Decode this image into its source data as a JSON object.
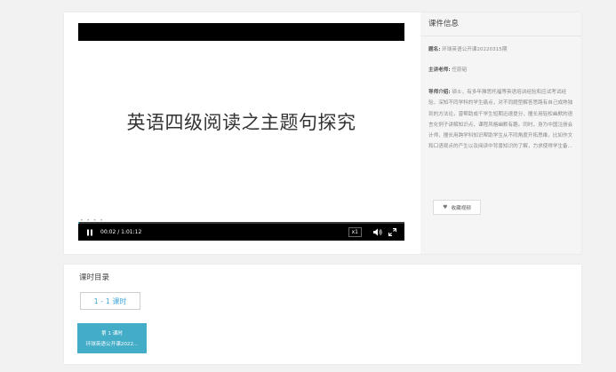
{
  "player": {
    "slide_title": "英语四级阅读之主题句探究",
    "time": "00:02 / 1:01:12",
    "rate": "x1",
    "progress": 0.0005,
    "progress_dots": "• • • •"
  },
  "info": {
    "header": "课件信息",
    "title_label": "题名:",
    "title_value": "环球英语公开课20220315期",
    "teacher_label": "主讲老师:",
    "teacher_value": "任蔚韬",
    "intro_label": "导师介绍:",
    "intro_value": "硕士，有多年雅思托福等英语培训经验和应试考试经验，深知不同学科的学生痛点，对不同题型解答思路有自己成熟独到的方法论，曾帮助成千学生短期迅速提分，擅长用轻松幽默的语言化例子讲解知识点，课程风格幽默有趣。同时，身为中国注册会计师，擅长用跨学科知识帮助学生从不同角度开拓思维，比如作文和口语观点的产生以及阅读中背景知识的了解，力求使得学生备...",
    "fav_label": "收藏视频"
  },
  "directory": {
    "title": "课时目录",
    "range_label": "1 - 1 课时",
    "lessons": [
      {
        "number": "第 1 课时",
        "name": "环球英语公开课2022..."
      }
    ]
  },
  "colors": {
    "accent": "#3ca6d9",
    "lesson_card": "#43adc8"
  }
}
